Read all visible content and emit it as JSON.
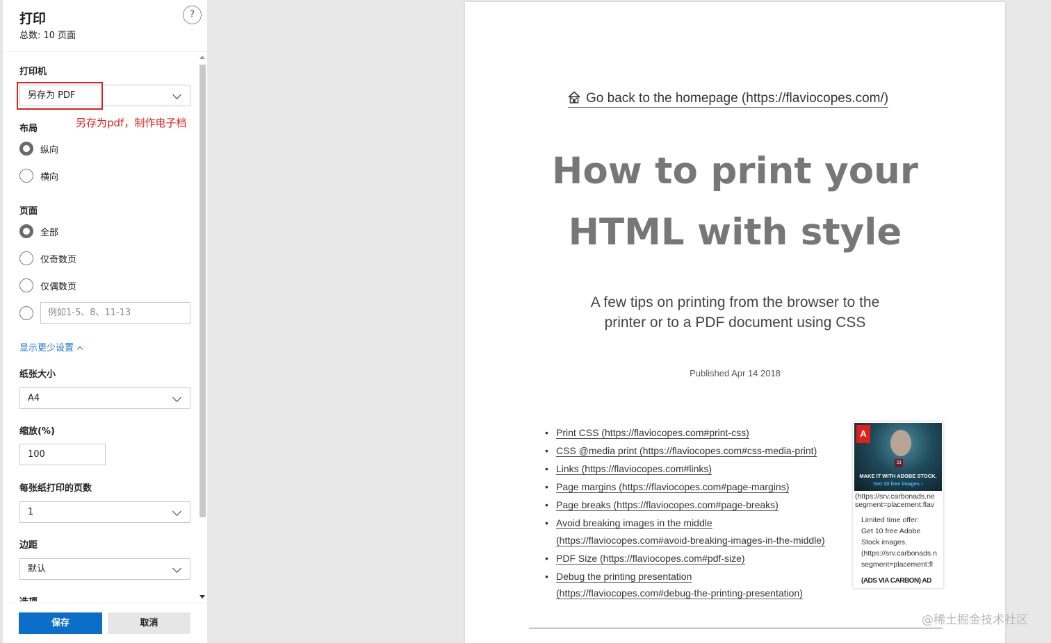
{
  "panel": {
    "title": "打印",
    "subtitle": "总数: 10 页面",
    "help_label": "?",
    "printer": {
      "label": "打印机",
      "value": "另存为 PDF"
    },
    "annotation": "另存为pdf，制作电子档",
    "layout": {
      "label": "布局",
      "options": [
        "纵向",
        "横向"
      ],
      "selected": "纵向"
    },
    "pages": {
      "label": "页面",
      "options": [
        "全部",
        "仅奇数页",
        "仅偶数页"
      ],
      "selected": "全部",
      "custom_placeholder": "例如1-5、8、11-13"
    },
    "show_less": "显示更少设置",
    "paper_size": {
      "label": "纸张大小",
      "value": "A4"
    },
    "scale": {
      "label": "缩放(%)",
      "value": "100"
    },
    "pages_per_sheet": {
      "label": "每张纸打印的页数",
      "value": "1"
    },
    "margins": {
      "label": "边距",
      "value": "默认"
    },
    "options_label": "选项",
    "save_label": "保存",
    "cancel_label": "取消"
  },
  "preview": {
    "home_link": "Go back to the homepage (https://flaviocopes.com/)",
    "title_line1": "How to print your",
    "title_line2": "HTML with style",
    "subtitle_line1": "A few tips on printing from the browser to the",
    "subtitle_line2": "printer or to a PDF document using CSS",
    "published": "Published Apr 14 2018",
    "toc": [
      [
        "Print CSS (https://flaviocopes.com#print-css)"
      ],
      [
        "CSS @media print (https://flaviocopes.com#css-media-print)"
      ],
      [
        "Links (https://flaviocopes.com#links)"
      ],
      [
        "Page margins (https://flaviocopes.com#page-margins)"
      ],
      [
        "Page breaks (https://flaviocopes.com#page-breaks)"
      ],
      [
        "Avoid breaking images in the middle",
        "(https://flaviocopes.com#avoid-breaking-images-in-the-middle)"
      ],
      [
        "PDF Size (https://flaviocopes.com#pdf-size)"
      ],
      [
        "Debug the printing presentation",
        "(https://flaviocopes.com#debug-the-printing-presentation)"
      ]
    ],
    "ad": {
      "logo": "Adobe",
      "badge": "St",
      "caption1": "MAKE IT WITH ADOBE STOCK.",
      "caption2": "Get 10 free images ›",
      "url_line1": "(https://srv.carbonads.ne",
      "url_line2": "segment=placement:flav",
      "offer_line1": "Limited time offer:",
      "offer_line2": "Get 10 free Adobe",
      "offer_line3": "Stock images.",
      "offer_line4": "(https://srv.carbonads.n",
      "offer_line5": "segment=placement:fl",
      "footer": "(ADS VIA CARBON) AD"
    }
  },
  "watermark": "@稀土掘金技术社区",
  "colors": {
    "accent": "#0b6fc9",
    "annotation": "#e02020",
    "link": "#1a73d0",
    "backdrop": "#e8e8e8"
  }
}
